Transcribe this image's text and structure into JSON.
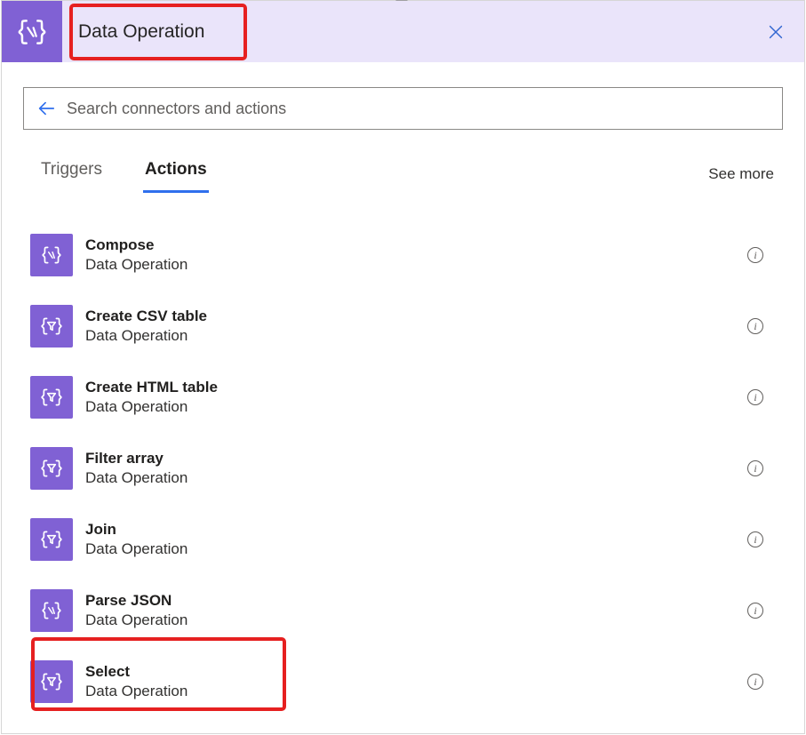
{
  "header": {
    "title": "Data Operation",
    "icon": "code-braces-icon",
    "close": "close"
  },
  "search": {
    "placeholder": "Search connectors and actions",
    "value": ""
  },
  "tabs": {
    "triggers": "Triggers",
    "actions": "Actions",
    "active": "actions",
    "see_more": "See more"
  },
  "actions": [
    {
      "title": "Compose",
      "subtitle": "Data Operation",
      "icon": "code-braces-icon"
    },
    {
      "title": "Create CSV table",
      "subtitle": "Data Operation",
      "icon": "filter-braces-icon"
    },
    {
      "title": "Create HTML table",
      "subtitle": "Data Operation",
      "icon": "filter-braces-icon"
    },
    {
      "title": "Filter array",
      "subtitle": "Data Operation",
      "icon": "filter-braces-icon"
    },
    {
      "title": "Join",
      "subtitle": "Data Operation",
      "icon": "filter-braces-icon"
    },
    {
      "title": "Parse JSON",
      "subtitle": "Data Operation",
      "icon": "code-braces-icon"
    },
    {
      "title": "Select",
      "subtitle": "Data Operation",
      "icon": "filter-braces-icon"
    }
  ]
}
